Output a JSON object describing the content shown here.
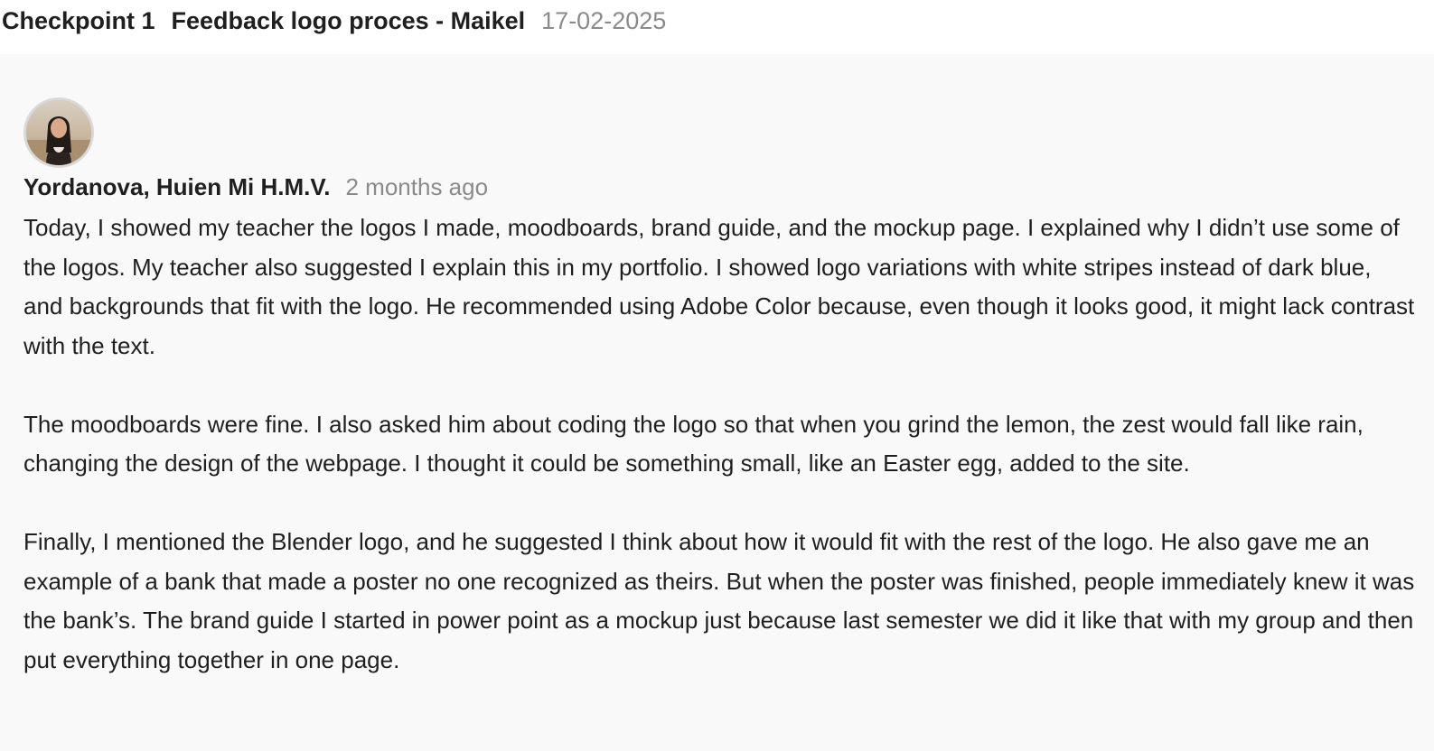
{
  "header": {
    "checkpoint": "Checkpoint 1",
    "title": "Feedback logo proces - Maikel",
    "date": "17-02-2025"
  },
  "comment": {
    "author": "Yordanova, Huien Mi H.M.V.",
    "timestamp": "2 months ago",
    "avatar_icon": "user-avatar-photo",
    "paragraphs": [
      "Today, I showed my teacher the logos I made, moodboards, brand guide, and the mockup page. I explained why I didn’t use some of the logos. My teacher also suggested I explain this in my portfolio. I showed logo variations with white stripes instead of dark blue, and backgrounds that fit with the logo. He recommended using Adobe Color because, even though it looks good, it might lack contrast with the text.",
      "The moodboards were fine. I also asked him about coding the logo so that when you grind the lemon, the zest would fall like rain, changing the design of the webpage. I thought it could be something small, like an Easter egg, added to the site.",
      "Finally, I mentioned the Blender logo, and he suggested I think about how it would fit with the rest of the logo. He also gave me an example of a bank that made a poster no one recognized as theirs. But when the poster was finished, people immediately knew it was the bank’s. The brand guide I started in power point as a mockup just because last semester we did it like that with my group and then put everything together in one page."
    ]
  },
  "colors": {
    "page_background": "#f9f9f9",
    "header_background": "#ffffff",
    "text_primary": "#1f1f1f",
    "text_muted": "#8a8a8a"
  }
}
